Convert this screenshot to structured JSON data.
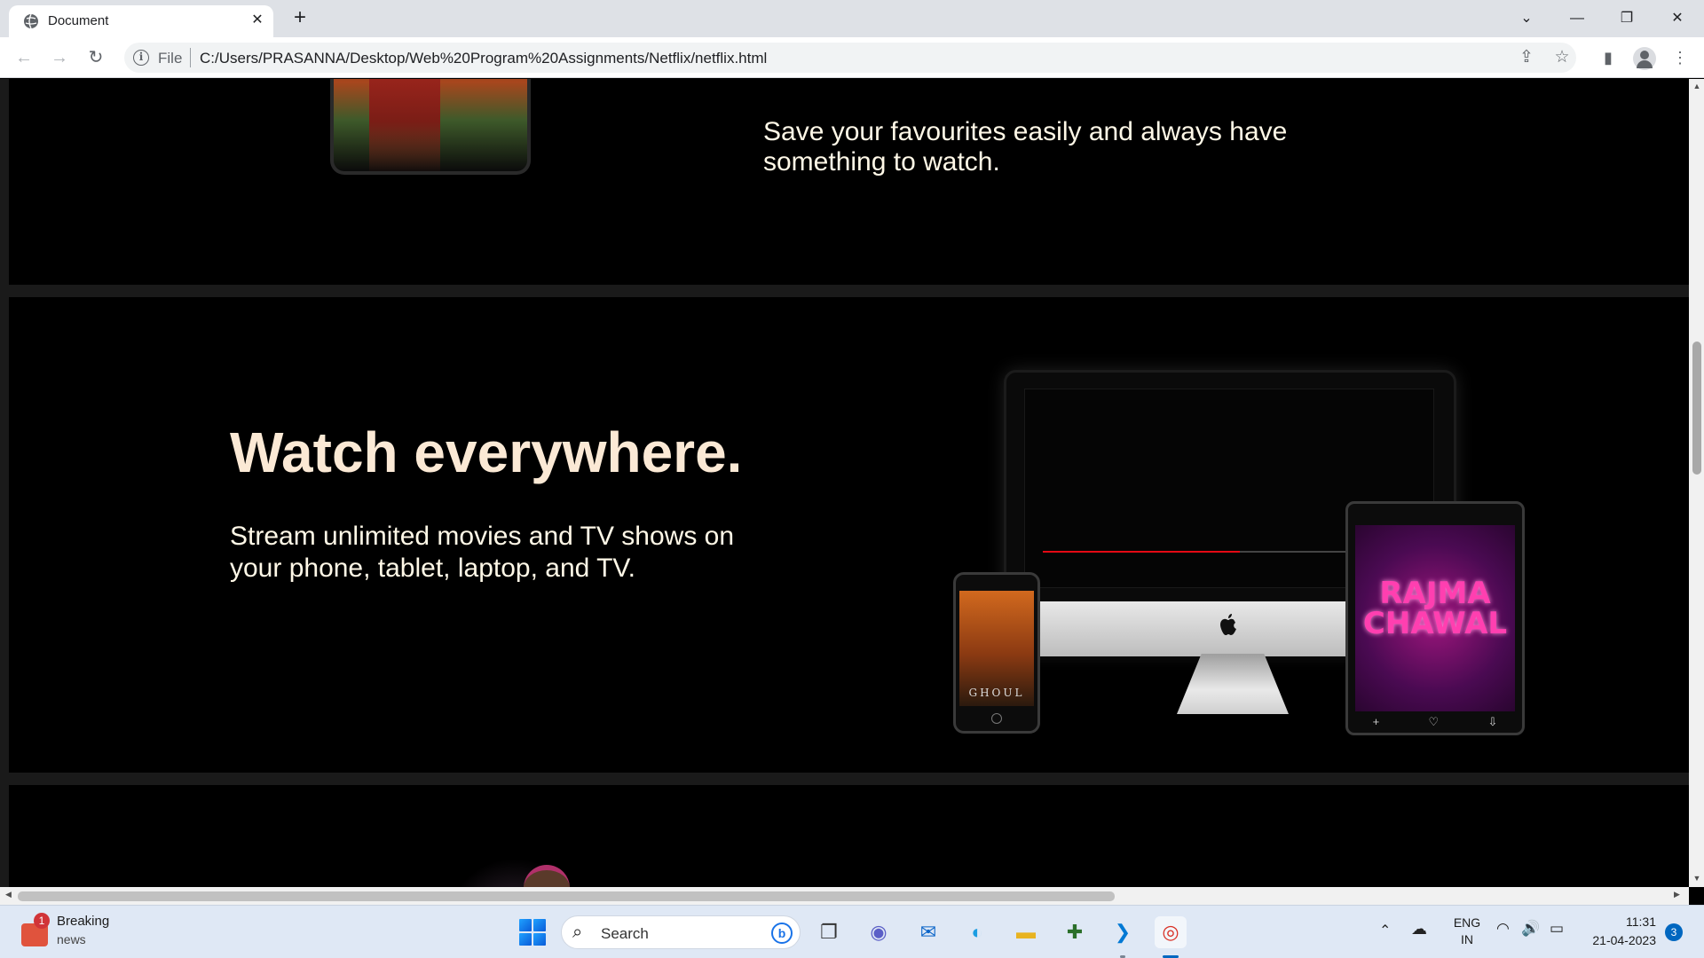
{
  "browser": {
    "tab_title": "Document",
    "tab_close": "✕",
    "new_tab": "+",
    "window_controls": {
      "tab_search": "⌄",
      "minimize": "—",
      "restore": "❐",
      "close": "✕"
    },
    "nav": {
      "back": "←",
      "forward": "→",
      "reload": "↻"
    },
    "omnibox": {
      "info_icon": "i",
      "scheme_label": "File",
      "url": "C:/Users/PRASANNA/Desktop/Web%20Program%20Assignments/Netflix/netflix.html"
    },
    "actions": {
      "share": "⇪",
      "bookmark": "☆",
      "side_panel": "▮",
      "menu": "⋮"
    }
  },
  "page": {
    "favourites_section": {
      "description": "Save your favourites easily and always have something to watch."
    },
    "watch_section": {
      "title": "Watch everywhere.",
      "description": "Stream unlimited movies and TV shows on your phone, tablet, laptop, and TV.",
      "phone_poster_title": "GHOUL",
      "tablet_poster_title": "RAJMA CHAWAL",
      "tablet_controls": [
        "+",
        "♡",
        "⇩"
      ]
    }
  },
  "scrollbars": {
    "up": "▲",
    "down": "▼",
    "left": "◀",
    "right": "▶"
  },
  "taskbar": {
    "news": {
      "badge": "1",
      "title": "Breaking",
      "subtitle": "news"
    },
    "search": {
      "label": "Search",
      "bing_icon": "b"
    },
    "apps": [
      {
        "name": "task-view",
        "glyph": "❐"
      },
      {
        "name": "teams",
        "glyph": "◉"
      },
      {
        "name": "mail",
        "glyph": "✉"
      },
      {
        "name": "edge",
        "glyph": "◐"
      },
      {
        "name": "file-explorer",
        "glyph": "▬"
      },
      {
        "name": "app-store",
        "glyph": "✚"
      },
      {
        "name": "vscode",
        "glyph": "❯"
      },
      {
        "name": "chrome",
        "glyph": "◎"
      }
    ],
    "tray": {
      "chevron": "⌃",
      "onedrive": "☁",
      "lang_line1": "ENG",
      "lang_line2": "IN",
      "wifi": "◠",
      "volume": "🔊",
      "battery": "▭",
      "time": "11:31",
      "date": "21-04-2023",
      "notifications": "3"
    }
  }
}
